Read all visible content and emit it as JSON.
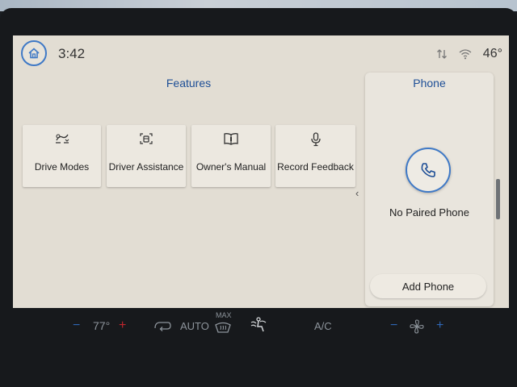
{
  "status_bar": {
    "time": "3:42",
    "outside_temp": "46°"
  },
  "icons": {
    "home": "home-icon",
    "signal": "data-arrows-icon",
    "wifi": "wifi-icon",
    "drive_modes": "drive-modes-icon",
    "driver_assistance": "driver-assistance-icon",
    "owners_manual": "book-icon",
    "record_feedback": "microphone-icon",
    "phone": "phone-icon",
    "fan": "fan-icon"
  },
  "features": {
    "title": "Features",
    "tiles": [
      {
        "label": "Drive Modes"
      },
      {
        "label": "Driver Assistance"
      },
      {
        "label": "Owner's Manual"
      },
      {
        "label": "Record Feedback"
      }
    ],
    "collapse_glyph": "‹"
  },
  "phone": {
    "title": "Phone",
    "status": "No Paired Phone",
    "add_button": "Add Phone"
  },
  "climate": {
    "minus": "−",
    "plus": "+",
    "driver_temp": "77°",
    "auto_label": "AUTO",
    "max_label": "MAX",
    "ac_label": "A/C"
  },
  "colors": {
    "accent": "#1d4e96",
    "ring": "#3f79c6",
    "heat": "#c0262d",
    "screen_bg": "#e2ddd3"
  }
}
